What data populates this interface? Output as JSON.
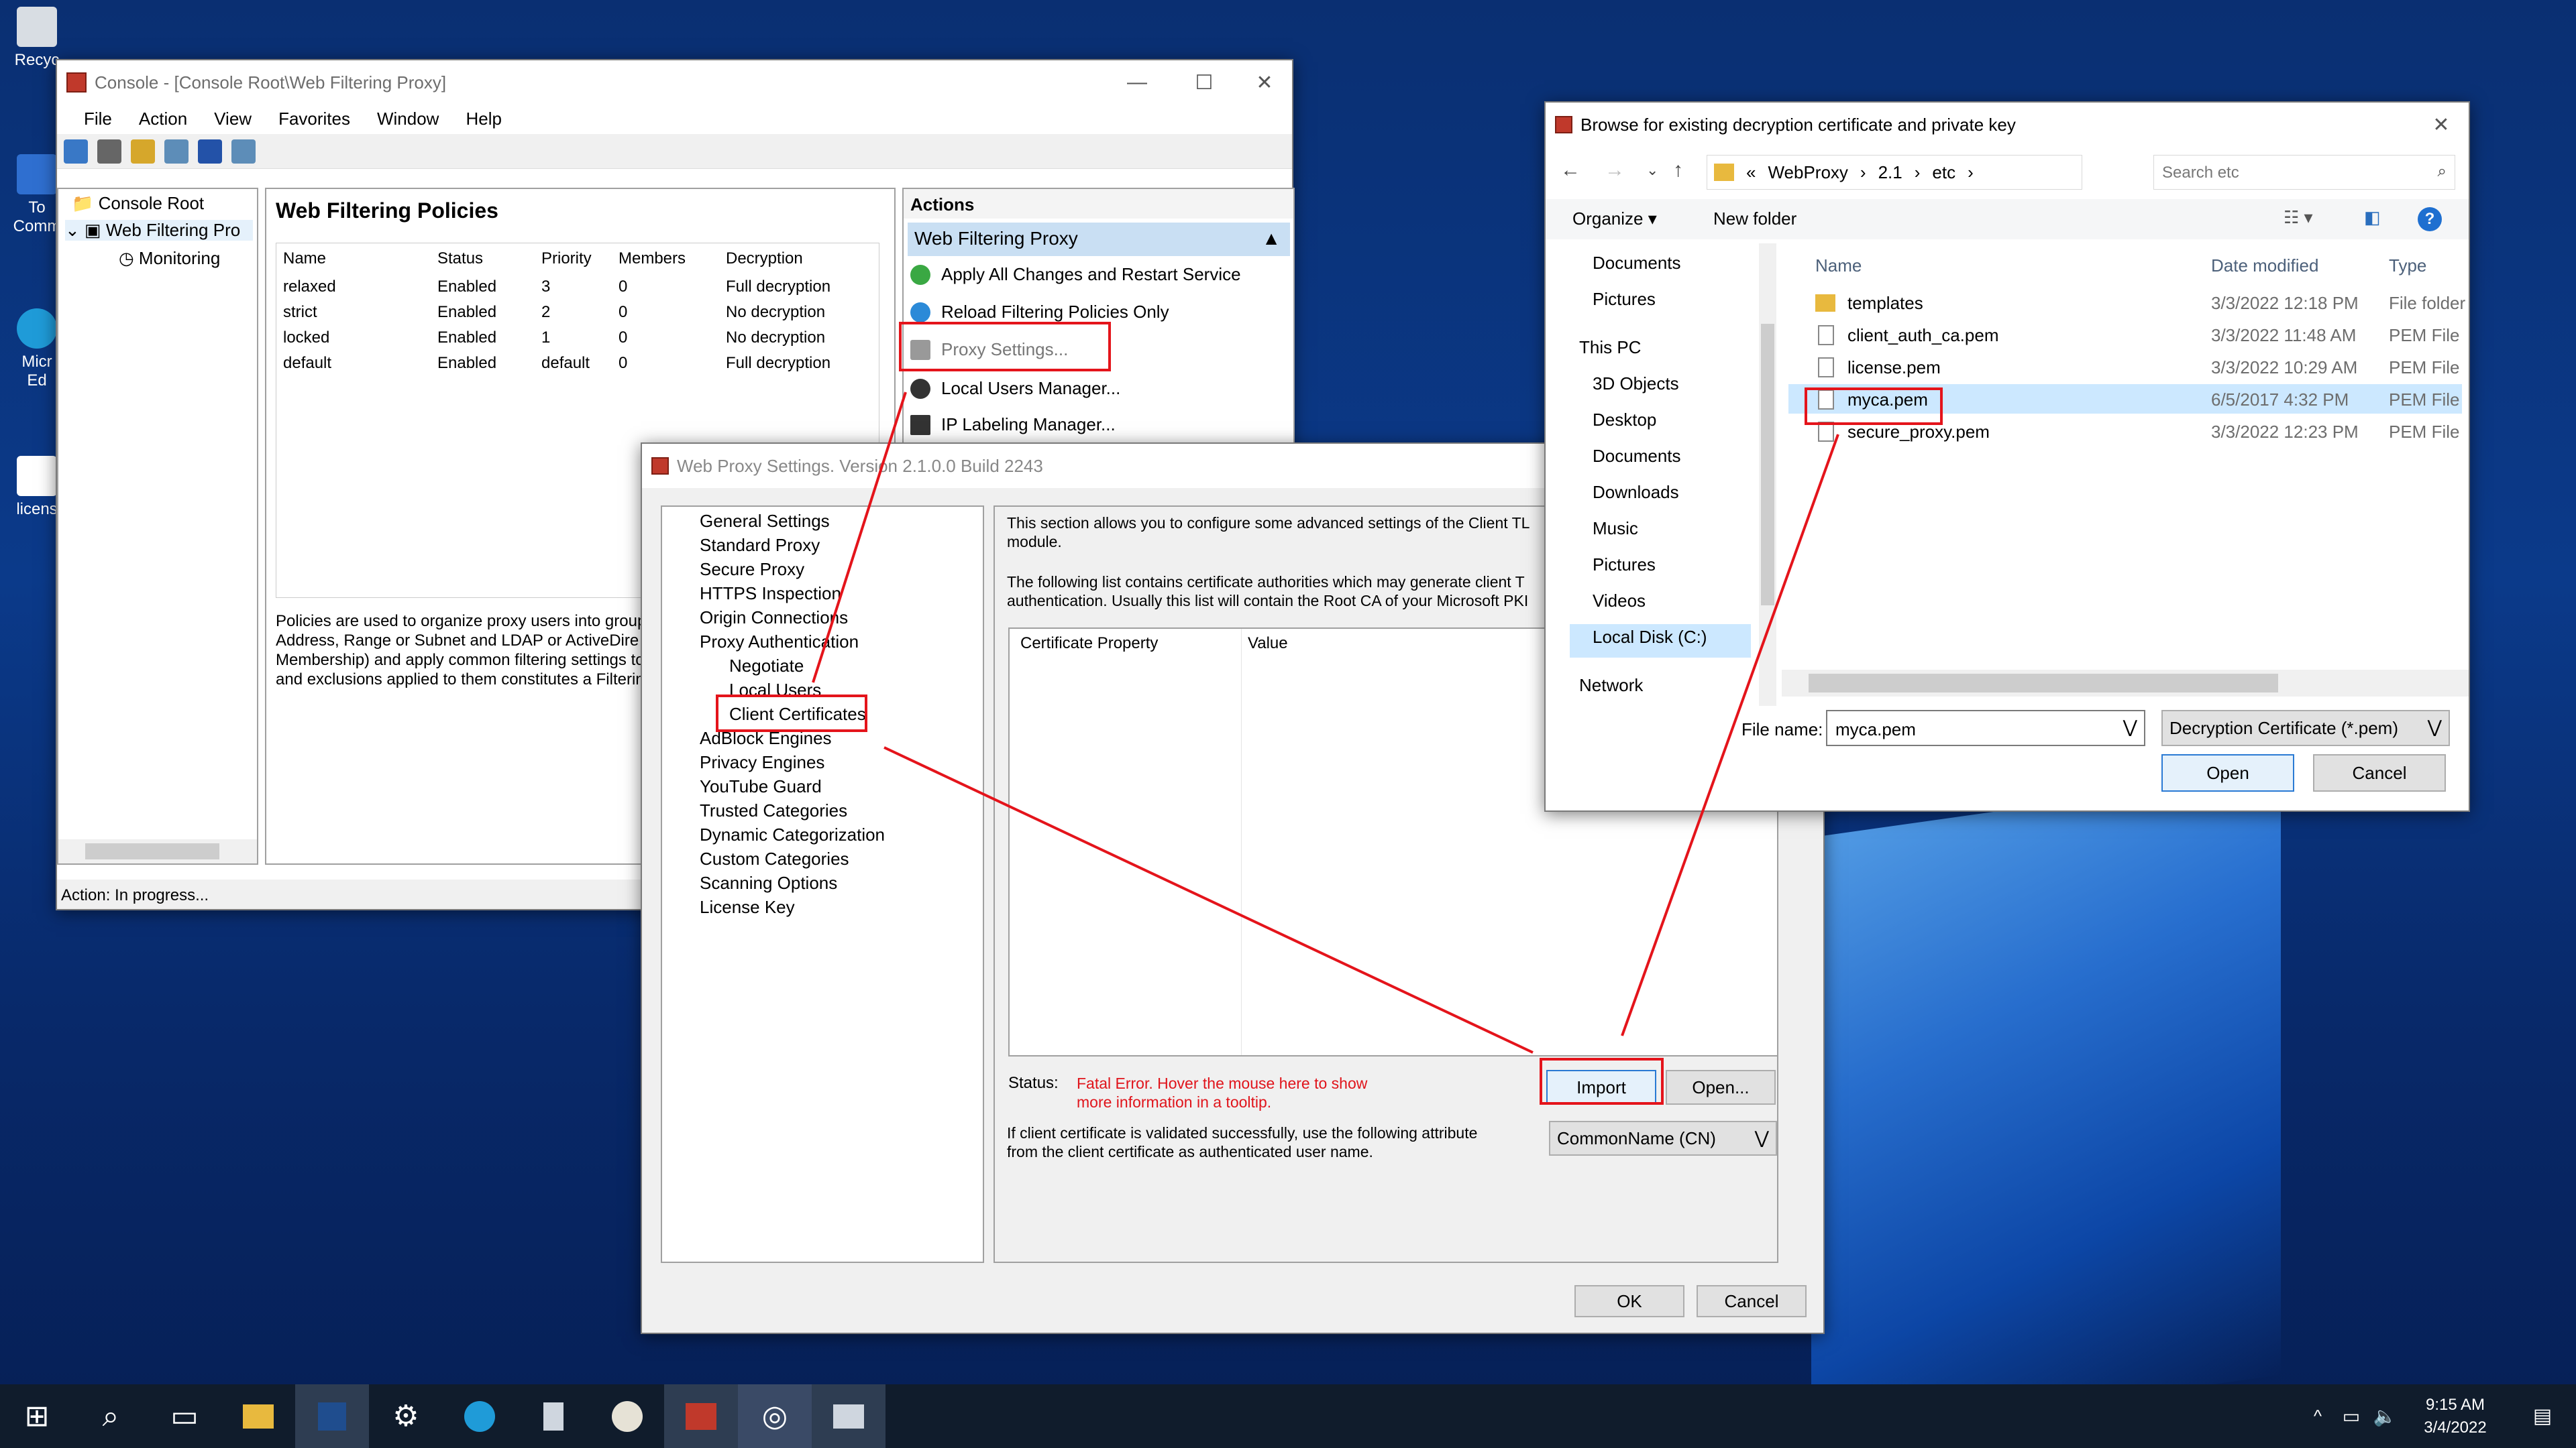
{
  "desktop": {
    "icons": [
      {
        "label": "Recyc"
      },
      {
        "label": "To\nComm"
      },
      {
        "label": "Micr\nEd"
      },
      {
        "label": "licens"
      }
    ]
  },
  "console": {
    "title": "Console - [Console Root\\Web Filtering Proxy]",
    "menu": [
      "File",
      "Action",
      "View",
      "Favorites",
      "Window",
      "Help"
    ],
    "tree": {
      "root": "Console Root",
      "child": "Web Filtering Pro",
      "sub": "Monitoring"
    },
    "main_title": "Web Filtering Policies",
    "columns": [
      "Name",
      "Status",
      "Priority",
      "Members",
      "Decryption"
    ],
    "rows": [
      [
        "relaxed",
        "Enabled",
        "3",
        "0",
        "Full decryption"
      ],
      [
        "strict",
        "Enabled",
        "2",
        "0",
        "No decryption"
      ],
      [
        "locked",
        "Enabled",
        "1",
        "0",
        "No decryption"
      ],
      [
        "default",
        "Enabled",
        "default",
        "0",
        "Full decryption"
      ]
    ],
    "description": "Policies are used to organize proxy users into groups\nAddress, Range or Subnet and LDAP or ActiveDire\nMembership) and apply common filtering settings to t\nand exclusions applied to them constitutes a Filtering",
    "status": "Action:  In progress...",
    "actions": {
      "header": "Actions",
      "group": "Web Filtering Proxy",
      "items": [
        "Apply All Changes and Restart Service",
        "Reload Filtering Policies Only",
        "Proxy Settings...",
        "Local Users Manager...",
        "IP Labeling Manager..."
      ]
    }
  },
  "settings": {
    "title": "Web Proxy Settings. Version 2.1.0.0 Build 2243",
    "tree": [
      "General Settings",
      "Standard Proxy",
      "Secure Proxy",
      "HTTPS Inspection",
      "Origin Connections",
      "Proxy Authentication",
      "Negotiate",
      "Local Users",
      "Client Certificates",
      "AdBlock Engines",
      "Privacy Engines",
      "YouTube Guard",
      "Trusted Categories",
      "Dynamic Categorization",
      "Custom Categories",
      "Scanning Options",
      "License Key"
    ],
    "intro1": "This section allows you to configure some advanced settings of the Client TL\nmodule.",
    "intro2": "The following list contains certificate authorities which may generate client T\nauthentication. Usually this list will contain the Root CA of your Microsoft PKI",
    "col1": "Certificate Property",
    "col2": "Value",
    "status_label": "Status:",
    "status_text": "Fatal Error. Hover the mouse here to show\nmore information in a tooltip.",
    "import": "Import",
    "open": "Open...",
    "attr_text": "If client certificate is validated successfully, use the following attribute\nfrom the client certificate as authenticated user name.",
    "attr_value": "CommonName (CN)",
    "ok": "OK",
    "cancel": "Cancel"
  },
  "browse": {
    "title": "Browse for existing decryption certificate and private key",
    "path": [
      "WebProxy",
      "2.1",
      "etc"
    ],
    "search_placeholder": "Search etc",
    "organize": "Organize",
    "new_folder": "New folder",
    "nav": [
      "Documents",
      "Pictures",
      "This PC",
      "3D Objects",
      "Desktop",
      "Documents",
      "Downloads",
      "Music",
      "Pictures",
      "Videos",
      "Local Disk (C:)",
      "Network"
    ],
    "cols": [
      "Name",
      "Date modified",
      "Type"
    ],
    "files": [
      [
        "templates",
        "3/3/2022 12:18 PM",
        "File folder"
      ],
      [
        "client_auth_ca.pem",
        "3/3/2022 11:48 AM",
        "PEM File"
      ],
      [
        "license.pem",
        "3/3/2022 10:29 AM",
        "PEM File"
      ],
      [
        "myca.pem",
        "6/5/2017 4:32 PM",
        "PEM File"
      ],
      [
        "secure_proxy.pem",
        "3/3/2022 12:23 PM",
        "PEM File"
      ]
    ],
    "filename_label": "File name:",
    "filename": "myca.pem",
    "filter": "Decryption Certificate (*.pem)",
    "open": "Open",
    "cancel": "Cancel"
  },
  "taskbar": {
    "time": "9:15 AM",
    "date": "3/4/2022"
  }
}
